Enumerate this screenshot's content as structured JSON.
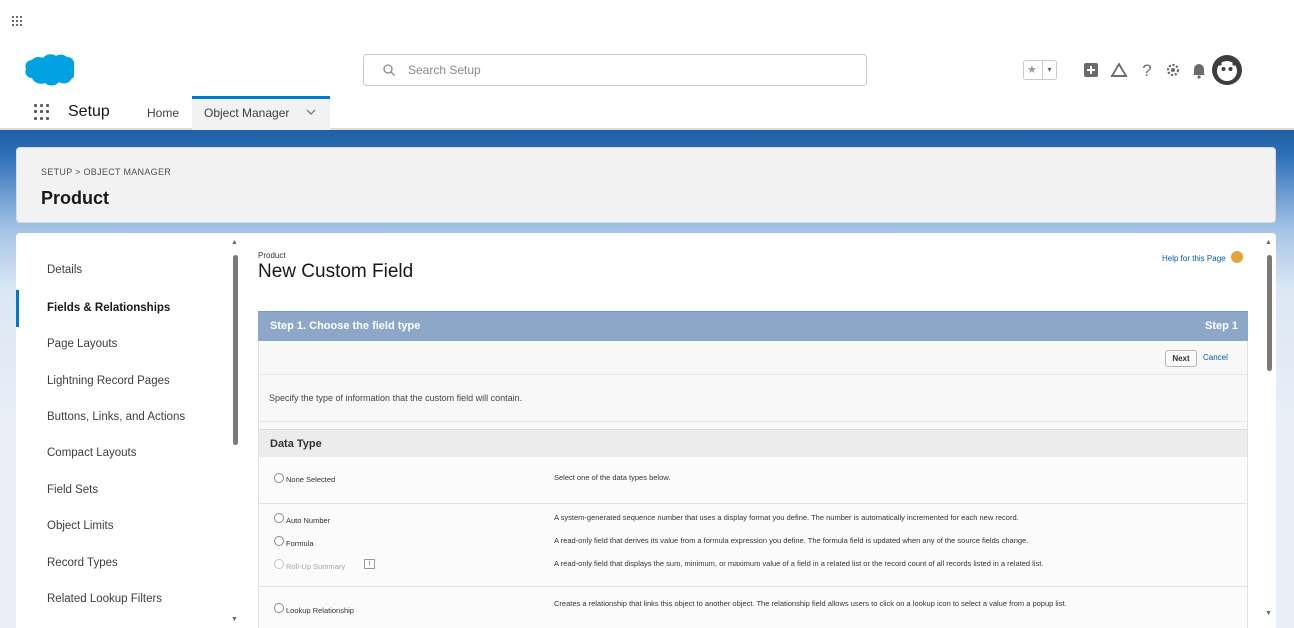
{
  "header": {
    "search_placeholder": "Search Setup"
  },
  "app_nav": {
    "app_name": "Setup",
    "tabs": [
      {
        "label": "Home"
      },
      {
        "label": "Object Manager"
      }
    ]
  },
  "page_header": {
    "breadcrumb": "SETUP > OBJECT MANAGER",
    "title": "Product"
  },
  "left_nav": {
    "items": [
      {
        "label": "Details"
      },
      {
        "label": "Fields & Relationships",
        "active": true
      },
      {
        "label": "Page Layouts"
      },
      {
        "label": "Lightning Record Pages"
      },
      {
        "label": "Buttons, Links, and Actions"
      },
      {
        "label": "Compact Layouts"
      },
      {
        "label": "Field Sets"
      },
      {
        "label": "Object Limits"
      },
      {
        "label": "Record Types"
      },
      {
        "label": "Related Lookup Filters"
      }
    ]
  },
  "content": {
    "object_label": "Product",
    "title": "New Custom Field",
    "help_link": "Help for this Page",
    "step_title": "Step 1. Choose the field type",
    "step_count": "Step 1",
    "next_label": "Next",
    "cancel_label": "Cancel",
    "specify_text": "Specify the type of information that the custom field will contain.",
    "data_type_heading": "Data Type",
    "options": [
      {
        "label": "None Selected",
        "description": "Select one of the data types below."
      },
      {
        "label": "Auto Number",
        "description": "A system-generated sequence number that uses a display format you define. The number is automatically incremented for each new record."
      },
      {
        "label": "Formula",
        "description": "A read-only field that derives its value from a formula expression you define. The formula field is updated when any of the source fields change."
      },
      {
        "label": "Roll-Up Summary",
        "description": "A read-only field that displays the sum, minimum, or maximum value of a field in a related list or the record count of all records listed in a related list.",
        "disabled": true
      },
      {
        "label": "Lookup Relationship",
        "description": "Creates a relationship that links this object to another object. The relationship field allows users to click on a lookup icon to select a value from a popup list."
      }
    ]
  },
  "colors": {
    "brand_blue": "#0176d3",
    "step_bar": "#8da7c9",
    "logo_blue": "#00a1e0"
  }
}
